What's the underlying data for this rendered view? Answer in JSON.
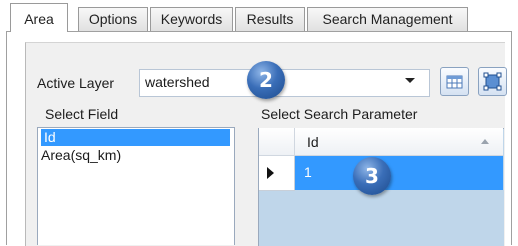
{
  "tabs": [
    {
      "label": "Area",
      "active": true
    },
    {
      "label": "Options",
      "active": false
    },
    {
      "label": "Keywords",
      "active": false
    },
    {
      "label": "Results",
      "active": false
    },
    {
      "label": "Search Management",
      "active": false
    }
  ],
  "active_layer": {
    "label": "Active Layer",
    "value": "watershed",
    "icons": [
      "table-icon",
      "select-features-icon"
    ]
  },
  "select_field": {
    "label": "Select Field",
    "items": [
      {
        "label": "Id",
        "selected": true
      },
      {
        "label": "Area(sq_km)",
        "selected": false
      }
    ]
  },
  "search_parameter": {
    "label": "Select Search Parameter",
    "column_header": "Id",
    "rows": [
      {
        "value": "1",
        "selected": true
      }
    ]
  },
  "callouts": [
    "2",
    "3"
  ],
  "colors": {
    "selection": "#3399ff",
    "grid_background": "#bfd6ea",
    "callout": "#2f63ad"
  }
}
